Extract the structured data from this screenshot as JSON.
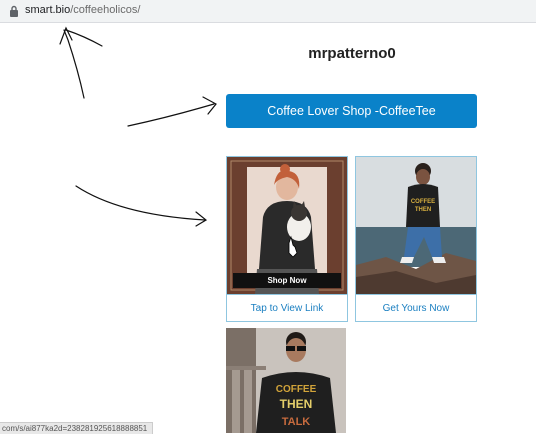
{
  "browser": {
    "url_host": "smart.bio",
    "url_path": "/coffeeholicos/"
  },
  "profile": {
    "username": "mrpatterno0"
  },
  "links": {
    "main_label": "Coffee Lover Shop -CoffeeTee"
  },
  "cards": [
    {
      "caption": "Tap to View Link",
      "overlay": "Shop Now",
      "image": "woman-with-cat-photo"
    },
    {
      "caption": "Get Yours Now",
      "image": "man-on-rocks-photo"
    },
    {
      "image": "man-in-coffee-shirt-photo",
      "shirt_text": [
        "COFFEE",
        "THEN",
        "TALK"
      ]
    }
  ],
  "status_bar": {
    "text": "com/s/ai877ka2d=238281925618888851"
  },
  "colors": {
    "accent": "#0a82c9",
    "card_border": "#8fc6e0"
  }
}
